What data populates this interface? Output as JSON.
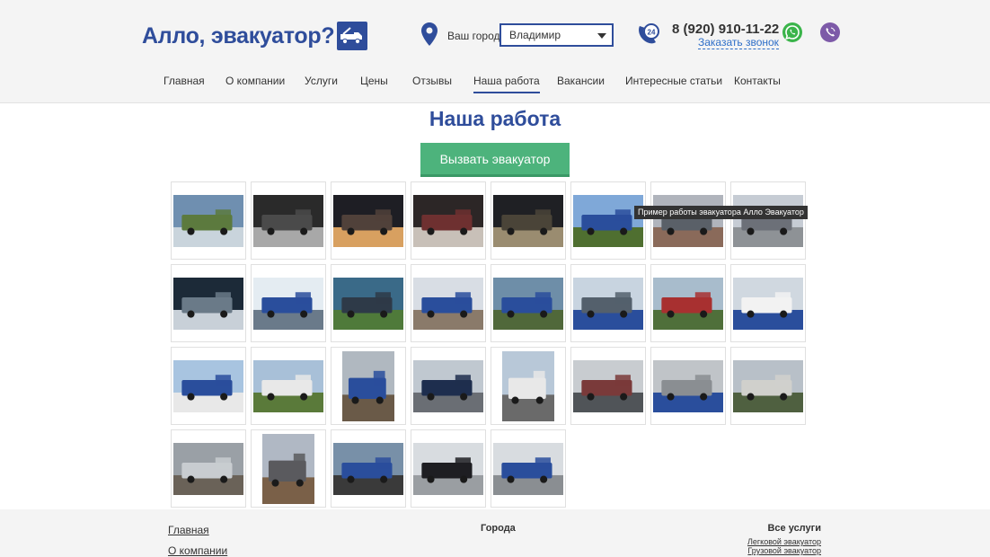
{
  "header": {
    "logo_text": "Алло, эвакуатор?",
    "city_label": "Ваш город:",
    "city_selected": "Владимир",
    "phone_badge": "24",
    "phone": "8 (920) 910-11-22",
    "callback": "Заказать звонок"
  },
  "nav": {
    "items": [
      {
        "label": "Главная"
      },
      {
        "label": "О компании"
      },
      {
        "label": "Услуги"
      },
      {
        "label": "Цены"
      },
      {
        "label": "Отзывы"
      },
      {
        "label": "Наша работа",
        "active": true
      },
      {
        "label": "Вакансии"
      },
      {
        "label": "Интересные статьи"
      },
      {
        "label": "Контакты"
      }
    ]
  },
  "page": {
    "title": "Наша работа",
    "cta": "Вызвать эвакуатор",
    "tooltip": "Пример работы эвакуатора Алло Эвакуатор"
  },
  "gallery": {
    "photos": [
      {
        "tone": [
          "#6f8fb0",
          "#5c7a3e",
          "#c9d4dc"
        ],
        "orient": "land"
      },
      {
        "tone": [
          "#2a2a2a",
          "#4a4a4a",
          "#a8a8a8"
        ],
        "orient": "land"
      },
      {
        "tone": [
          "#1e1e24",
          "#50413a",
          "#d8a060"
        ],
        "orient": "land"
      },
      {
        "tone": [
          "#2c2626",
          "#6e3030",
          "#c8c0b8"
        ],
        "orient": "land"
      },
      {
        "tone": [
          "#1f2024",
          "#4a4438",
          "#9a8c70"
        ],
        "orient": "land"
      },
      {
        "tone": [
          "#7fa8d8",
          "#2a4e9c",
          "#4f6f30"
        ],
        "orient": "land"
      },
      {
        "tone": [
          "#b0b4bc",
          "#5a6068",
          "#8a6a5a"
        ],
        "orient": "land"
      },
      {
        "tone": [
          "#c6ccd4",
          "#6c7078",
          "#8e9296"
        ],
        "orient": "land"
      },
      {
        "tone": [
          "#1c2a38",
          "#6a7a88",
          "#c8d0d8"
        ],
        "orient": "land"
      },
      {
        "tone": [
          "#e4ecf2",
          "#2a4e9c",
          "#6a7a8a"
        ],
        "orient": "land"
      },
      {
        "tone": [
          "#3a6a88",
          "#2e3a48",
          "#4f7a3a"
        ],
        "orient": "land"
      },
      {
        "tone": [
          "#d8dde4",
          "#2a4e9c",
          "#8a7a6a"
        ],
        "orient": "land"
      },
      {
        "tone": [
          "#6e8ea8",
          "#2a4e9c",
          "#50683a"
        ],
        "orient": "land"
      },
      {
        "tone": [
          "#c8d4e0",
          "#54606c",
          "#2a4e9c"
        ],
        "orient": "land"
      },
      {
        "tone": [
          "#a8bccc",
          "#a83030",
          "#4f6f3a"
        ],
        "orient": "land"
      },
      {
        "tone": [
          "#d0d8e0",
          "#f2f2f2",
          "#2a4e9c"
        ],
        "orient": "land"
      },
      {
        "tone": [
          "#a8c4e0",
          "#2a4e9c",
          "#e8e8e8"
        ],
        "orient": "land"
      },
      {
        "tone": [
          "#a8c0d8",
          "#e8e8e8",
          "#5a7a3a"
        ],
        "orient": "land"
      },
      {
        "tone": [
          "#b0b8c0",
          "#2a4e9c",
          "#6a5a48"
        ],
        "orient": "port"
      },
      {
        "tone": [
          "#c0c8d0",
          "#1e2e4e",
          "#6a6e74"
        ],
        "orient": "land"
      },
      {
        "tone": [
          "#b8c8d8",
          "#e8e8e8",
          "#6a6a6a"
        ],
        "orient": "port"
      },
      {
        "tone": [
          "#c8ccd0",
          "#7a3a3a",
          "#505458"
        ],
        "orient": "land"
      },
      {
        "tone": [
          "#c0c4c8",
          "#8a8e92",
          "#2a4e9c"
        ],
        "orient": "land"
      },
      {
        "tone": [
          "#b8c0c8",
          "#d0d0cc",
          "#4f6040"
        ],
        "orient": "land"
      },
      {
        "tone": [
          "#9aa0a6",
          "#c8ccd0",
          "#6a6258"
        ],
        "orient": "land"
      },
      {
        "tone": [
          "#b0b8c4",
          "#5a5a5e",
          "#7a6048"
        ],
        "orient": "port"
      },
      {
        "tone": [
          "#7890a8",
          "#2a4e9c",
          "#3a3a3a"
        ],
        "orient": "land"
      },
      {
        "tone": [
          "#d8dce0",
          "#1e1e22",
          "#9a9ea2"
        ],
        "orient": "land"
      },
      {
        "tone": [
          "#d8dce0",
          "#2a4e9c",
          "#8a8e92"
        ],
        "orient": "land"
      }
    ]
  },
  "footer": {
    "link_home": "Главная",
    "link_about": "О компании",
    "cities_head": "Города",
    "services_head": "Все услуги",
    "service_1": "Легковой эвакуатор",
    "service_2": "Грузовой эвакуатор"
  }
}
